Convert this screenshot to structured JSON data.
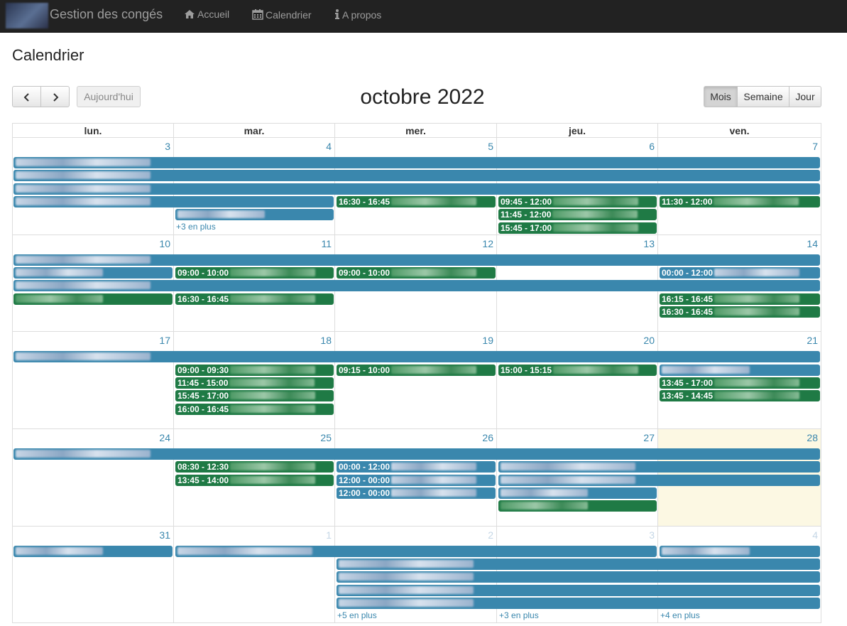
{
  "app": {
    "brand": "Gestion des congés"
  },
  "nav": [
    {
      "label": "Accueil",
      "icon": "home-icon"
    },
    {
      "label": "Calendrier",
      "icon": "calendar-icon"
    },
    {
      "label": "A propos",
      "icon": "info-icon"
    }
  ],
  "page": {
    "title": "Calendrier"
  },
  "calendar": {
    "title": "octobre 2022",
    "today_label": "Aujourd'hui",
    "views": [
      "Mois",
      "Semaine",
      "Jour"
    ],
    "active_view": "Mois",
    "day_headers": [
      "lun.",
      "mar.",
      "mer.",
      "jeu.",
      "ven."
    ],
    "weeks": [
      {
        "days": [
          "3",
          "4",
          "5",
          "6",
          "7"
        ],
        "other_month": [
          false,
          false,
          false,
          false,
          false
        ],
        "today_index": null,
        "events": [
          {
            "color": "blue",
            "start": 0,
            "span": 5,
            "lane": 0,
            "label": ""
          },
          {
            "color": "blue",
            "start": 0,
            "span": 5,
            "lane": 1,
            "label": ""
          },
          {
            "color": "blue",
            "start": 0,
            "span": 5,
            "lane": 2,
            "label": ""
          },
          {
            "color": "blue",
            "start": 0,
            "span": 2,
            "lane": 3,
            "label": ""
          },
          {
            "color": "green",
            "start": 2,
            "span": 1,
            "lane": 3,
            "label": "16:30 - 16:45"
          },
          {
            "color": "green",
            "start": 3,
            "span": 1,
            "lane": 3,
            "label": "09:45 - 12:00"
          },
          {
            "color": "green",
            "start": 4,
            "span": 1,
            "lane": 3,
            "label": "11:30 - 12:00"
          },
          {
            "color": "blue",
            "start": 1,
            "span": 1,
            "lane": 4,
            "label": ""
          },
          {
            "color": "green",
            "start": 3,
            "span": 1,
            "lane": 4,
            "label": "11:45 - 12:00"
          },
          {
            "color": "green",
            "start": 3,
            "span": 1,
            "lane": 5,
            "label": "15:45 - 17:00"
          }
        ],
        "more": [
          {
            "col": 1,
            "label": "+3 en plus"
          }
        ]
      },
      {
        "days": [
          "10",
          "11",
          "12",
          "13",
          "14"
        ],
        "other_month": [
          false,
          false,
          false,
          false,
          false
        ],
        "today_index": null,
        "events": [
          {
            "color": "blue",
            "start": 0,
            "span": 5,
            "lane": 0,
            "label": ""
          },
          {
            "color": "blue",
            "start": 0,
            "span": 1,
            "lane": 1,
            "label": ""
          },
          {
            "color": "green",
            "start": 1,
            "span": 1,
            "lane": 1,
            "label": "09:00 - 10:00"
          },
          {
            "color": "green",
            "start": 2,
            "span": 1,
            "lane": 1,
            "label": "09:00 - 10:00"
          },
          {
            "color": "blue",
            "start": 4,
            "span": 1,
            "lane": 1,
            "label": "00:00 - 12:00"
          },
          {
            "color": "blue",
            "start": 0,
            "span": 5,
            "lane": 2,
            "label": ""
          },
          {
            "color": "green",
            "start": 0,
            "span": 1,
            "lane": 3,
            "label": ""
          },
          {
            "color": "green",
            "start": 1,
            "span": 1,
            "lane": 3,
            "label": "16:30 - 16:45"
          },
          {
            "color": "green",
            "start": 4,
            "span": 1,
            "lane": 3,
            "label": "16:15 - 16:45"
          },
          {
            "color": "green",
            "start": 4,
            "span": 1,
            "lane": 4,
            "label": "16:30 - 16:45"
          }
        ],
        "more": []
      },
      {
        "days": [
          "17",
          "18",
          "19",
          "20",
          "21"
        ],
        "other_month": [
          false,
          false,
          false,
          false,
          false
        ],
        "today_index": null,
        "events": [
          {
            "color": "blue",
            "start": 0,
            "span": 5,
            "lane": 0,
            "label": ""
          },
          {
            "color": "green",
            "start": 1,
            "span": 1,
            "lane": 1,
            "label": "09:00 - 09:30"
          },
          {
            "color": "green",
            "start": 2,
            "span": 1,
            "lane": 1,
            "label": "09:15 - 10:00"
          },
          {
            "color": "green",
            "start": 3,
            "span": 1,
            "lane": 1,
            "label": "15:00 - 15:15"
          },
          {
            "color": "blue",
            "start": 4,
            "span": 1,
            "lane": 1,
            "label": ""
          },
          {
            "color": "green",
            "start": 1,
            "span": 1,
            "lane": 2,
            "label": "11:45 - 15:00"
          },
          {
            "color": "green",
            "start": 4,
            "span": 1,
            "lane": 2,
            "label": "13:45 - 17:00"
          },
          {
            "color": "green",
            "start": 1,
            "span": 1,
            "lane": 3,
            "label": "15:45 - 17:00"
          },
          {
            "color": "green",
            "start": 4,
            "span": 1,
            "lane": 3,
            "label": "13:45 - 14:45"
          },
          {
            "color": "green",
            "start": 1,
            "span": 1,
            "lane": 4,
            "label": "16:00 - 16:45"
          }
        ],
        "more": []
      },
      {
        "days": [
          "24",
          "25",
          "26",
          "27",
          "28"
        ],
        "other_month": [
          false,
          false,
          false,
          false,
          false
        ],
        "today_index": 4,
        "events": [
          {
            "color": "blue",
            "start": 0,
            "span": 5,
            "lane": 0,
            "label": ""
          },
          {
            "color": "green",
            "start": 1,
            "span": 1,
            "lane": 1,
            "label": "08:30 - 12:30"
          },
          {
            "color": "blue",
            "start": 2,
            "span": 1,
            "lane": 1,
            "label": "00:00 - 12:00"
          },
          {
            "color": "blue",
            "start": 3,
            "span": 2,
            "lane": 1,
            "label": ""
          },
          {
            "color": "green",
            "start": 1,
            "span": 1,
            "lane": 2,
            "label": "13:45 - 14:00"
          },
          {
            "color": "blue",
            "start": 2,
            "span": 1,
            "lane": 2,
            "label": "12:00 - 00:00"
          },
          {
            "color": "blue",
            "start": 3,
            "span": 2,
            "lane": 2,
            "label": ""
          },
          {
            "color": "blue",
            "start": 2,
            "span": 1,
            "lane": 3,
            "label": "12:00 - 00:00"
          },
          {
            "color": "blue",
            "start": 3,
            "span": 1,
            "lane": 3,
            "label": ""
          },
          {
            "color": "green",
            "start": 3,
            "span": 1,
            "lane": 4,
            "label": ""
          }
        ],
        "more": []
      },
      {
        "days": [
          "31",
          "1",
          "2",
          "3",
          "4"
        ],
        "other_month": [
          false,
          true,
          true,
          true,
          true
        ],
        "today_index": null,
        "events": [
          {
            "color": "blue",
            "start": 0,
            "span": 1,
            "lane": 0,
            "label": ""
          },
          {
            "color": "blue",
            "start": 1,
            "span": 3,
            "lane": 0,
            "label": ""
          },
          {
            "color": "blue",
            "start": 4,
            "span": 1,
            "lane": 0,
            "label": ""
          },
          {
            "color": "blue",
            "start": 2,
            "span": 3,
            "lane": 1,
            "label": ""
          },
          {
            "color": "blue",
            "start": 2,
            "span": 3,
            "lane": 2,
            "label": ""
          },
          {
            "color": "blue",
            "start": 2,
            "span": 3,
            "lane": 3,
            "label": ""
          },
          {
            "color": "blue",
            "start": 2,
            "span": 3,
            "lane": 4,
            "label": ""
          }
        ],
        "more": [
          {
            "col": 2,
            "label": "+5 en plus"
          },
          {
            "col": 3,
            "label": "+3 en plus"
          },
          {
            "col": 4,
            "label": "+4 en plus"
          }
        ]
      }
    ]
  }
}
